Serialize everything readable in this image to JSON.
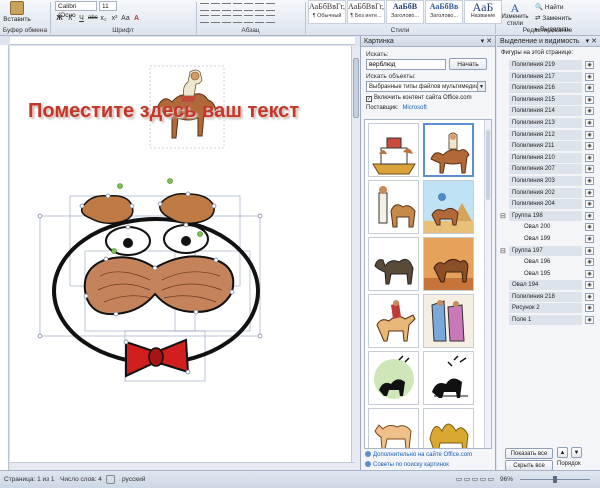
{
  "ribbon": {
    "paste_label": "Вставить",
    "font_name": "Calibri (Осно",
    "font_size": "11",
    "format_buttons": [
      "Ж",
      "К",
      "Ч",
      "abc",
      "x₂",
      "x²",
      "Аа",
      "A"
    ],
    "group_clipboard": "Буфер обмена",
    "group_font": "Шрифт",
    "group_paragraph": "Абзац",
    "group_styles": "Стили",
    "group_editing": "Редактирование",
    "styles": [
      {
        "sample": "АаБбВвГг,",
        "name": "¶ Обычный"
      },
      {
        "sample": "АаБбВвГг,",
        "name": "¶ Без инте..."
      },
      {
        "sample": "АаБбВ",
        "name": "Заголово..."
      },
      {
        "sample": "АаБбВв",
        "name": "Заголово..."
      },
      {
        "sample": "АаБ",
        "name": "Название"
      }
    ],
    "change_styles": "Изменить стили",
    "find": "Найти",
    "replace": "Заменить",
    "select": "Выделить"
  },
  "document": {
    "wordart_text": "Поместите здесь ваш текст"
  },
  "clipart_pane": {
    "title": "Картинка",
    "search_label": "Искать:",
    "search_value": "верблюд",
    "go_button": "Начать",
    "types_label": "Искать объекты:",
    "types_value": "Выбранные типы файлов мультимедиа",
    "include_office": "Включить контент сайта Office.com",
    "suppliers_label": "Поставщик:",
    "suppliers_value": "Microsoft",
    "link_more": "Дополнительно на сайте Office.com",
    "link_tips": "Советы по поиску картинок"
  },
  "selection_pane": {
    "title": "Выделение и видимость",
    "subtitle": "Фигуры на этой странице:",
    "items": [
      {
        "label": "Полилиния 219",
        "indent": 0,
        "group": false
      },
      {
        "label": "Полилиния 217",
        "indent": 0,
        "group": false
      },
      {
        "label": "Полилиния 216",
        "indent": 0,
        "group": false
      },
      {
        "label": "Полилиния 215",
        "indent": 0,
        "group": false
      },
      {
        "label": "Полилиния 214",
        "indent": 0,
        "group": false
      },
      {
        "label": "Полилиния 213",
        "indent": 0,
        "group": false
      },
      {
        "label": "Полилиния 212",
        "indent": 0,
        "group": false
      },
      {
        "label": "Полилиния 211",
        "indent": 0,
        "group": false
      },
      {
        "label": "Полилиния 210",
        "indent": 0,
        "group": false
      },
      {
        "label": "Полилиния 207",
        "indent": 0,
        "group": false
      },
      {
        "label": "Полилиния 203",
        "indent": 0,
        "group": false
      },
      {
        "label": "Полилиния 202",
        "indent": 0,
        "group": false
      },
      {
        "label": "Полилиния 204",
        "indent": 0,
        "group": false
      },
      {
        "label": "Группа 198",
        "indent": 1,
        "group": true
      },
      {
        "label": "Овал 200",
        "indent": 2,
        "group": false
      },
      {
        "label": "Овал 199",
        "indent": 2,
        "group": false
      },
      {
        "label": "Группа 197",
        "indent": 1,
        "group": true
      },
      {
        "label": "Овал 196",
        "indent": 2,
        "group": false
      },
      {
        "label": "Овал 195",
        "indent": 2,
        "group": false
      },
      {
        "label": "Овал 194",
        "indent": 0,
        "group": false
      },
      {
        "label": "Полилиния 218",
        "indent": 0,
        "group": false
      },
      {
        "label": "Рисунок 2",
        "indent": 0,
        "group": false
      },
      {
        "label": "Поле 1",
        "indent": 0,
        "group": false
      }
    ],
    "show_all": "Показать все",
    "hide_all": "Скрыть все",
    "reorder": "Порядок"
  },
  "status": {
    "page": "Страница: 1 из 1",
    "words": "Число слов: 4",
    "language": "русский",
    "zoom": "96%"
  }
}
